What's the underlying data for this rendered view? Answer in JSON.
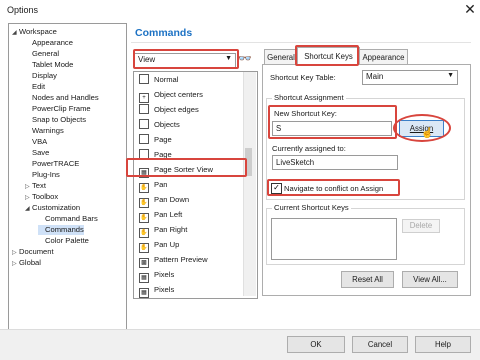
{
  "window": {
    "title": "Options",
    "close": "✕"
  },
  "tree": [
    {
      "label": "Workspace",
      "toggle": "◢",
      "depth": 0
    },
    {
      "label": "Appearance",
      "toggle": "",
      "depth": 1
    },
    {
      "label": "General",
      "toggle": "",
      "depth": 1
    },
    {
      "label": "Tablet Mode",
      "toggle": "",
      "depth": 1
    },
    {
      "label": "Display",
      "toggle": "",
      "depth": 1
    },
    {
      "label": "Edit",
      "toggle": "",
      "depth": 1
    },
    {
      "label": "Nodes and Handles",
      "toggle": "",
      "depth": 1
    },
    {
      "label": "PowerClip Frame",
      "toggle": "",
      "depth": 1
    },
    {
      "label": "Snap to Objects",
      "toggle": "",
      "depth": 1
    },
    {
      "label": "Warnings",
      "toggle": "",
      "depth": 1
    },
    {
      "label": "VBA",
      "toggle": "",
      "depth": 1
    },
    {
      "label": "Save",
      "toggle": "",
      "depth": 1
    },
    {
      "label": "PowerTRACE",
      "toggle": "",
      "depth": 1
    },
    {
      "label": "Plug-Ins",
      "toggle": "",
      "depth": 1
    },
    {
      "label": "Text",
      "toggle": "▷",
      "depth": 1
    },
    {
      "label": "Toolbox",
      "toggle": "▷",
      "depth": 1
    },
    {
      "label": "Customization",
      "toggle": "◢",
      "depth": 1
    },
    {
      "label": "Command Bars",
      "toggle": "",
      "depth": 2
    },
    {
      "label": "Commands",
      "toggle": "",
      "depth": 2,
      "selected": true
    },
    {
      "label": "Color Palette",
      "toggle": "",
      "depth": 2
    },
    {
      "label": "Document",
      "toggle": "▷",
      "depth": 0
    },
    {
      "label": "Global",
      "toggle": "▷",
      "depth": 0
    }
  ],
  "main": {
    "header": "Commands",
    "category": "View",
    "category_arrow": "▼",
    "find_icon": "binoculars-icon",
    "find_glyph": "👓",
    "commands": [
      {
        "label": "Normal",
        "icon": "normal-view-icon",
        "glyph": ""
      },
      {
        "label": "Object centers",
        "icon": "object-centers-icon",
        "glyph": "+"
      },
      {
        "label": "Object edges",
        "icon": "object-edges-icon",
        "glyph": ""
      },
      {
        "label": "Objects",
        "icon": "objects-icon",
        "glyph": ""
      },
      {
        "label": "Page",
        "icon": "page-icon",
        "glyph": ""
      },
      {
        "label": "Page",
        "icon": "page-icon",
        "glyph": ""
      },
      {
        "label": "Page Sorter View",
        "icon": "page-sorter-icon",
        "glyph": "▦"
      },
      {
        "label": "Pan",
        "icon": "pan-icon",
        "glyph": "✋"
      },
      {
        "label": "Pan Down",
        "icon": "pan-down-icon",
        "glyph": "✋"
      },
      {
        "label": "Pan Left",
        "icon": "pan-left-icon",
        "glyph": "✋"
      },
      {
        "label": "Pan Right",
        "icon": "pan-right-icon",
        "glyph": "✋"
      },
      {
        "label": "Pan Up",
        "icon": "pan-up-icon",
        "glyph": "✋"
      },
      {
        "label": "Pattern Preview",
        "icon": "pattern-preview-icon",
        "glyph": "▩"
      },
      {
        "label": "Pixels",
        "icon": "pixels-icon",
        "glyph": "▦"
      },
      {
        "label": "Pixels",
        "icon": "pixels-icon",
        "glyph": "▦"
      }
    ]
  },
  "tabs": {
    "general": "General",
    "shortcut_keys": "Shortcut Keys",
    "appearance": "Appearance"
  },
  "shortcut": {
    "table_label": "Shortcut Key Table:",
    "table_value": "Main",
    "table_arrow": "▼",
    "assignment_group": "Shortcut Assignment",
    "new_key_label": "New Shortcut Key:",
    "new_key_value": "S",
    "assign_button": "Assign",
    "currently_label": "Currently assigned to:",
    "currently_value": "LiveSketch",
    "navigate_label": "Navigate to conflict on Assign",
    "navigate_checked": "✓",
    "current_keys_label": "Current Shortcut Keys",
    "delete_button": "Delete",
    "reset_button": "Reset All",
    "view_all_button": "View All..."
  },
  "footer": {
    "ok": "OK",
    "cancel": "Cancel",
    "help": "Help"
  },
  "annotation_color": "#d8453d",
  "accent": "#1d72c4"
}
